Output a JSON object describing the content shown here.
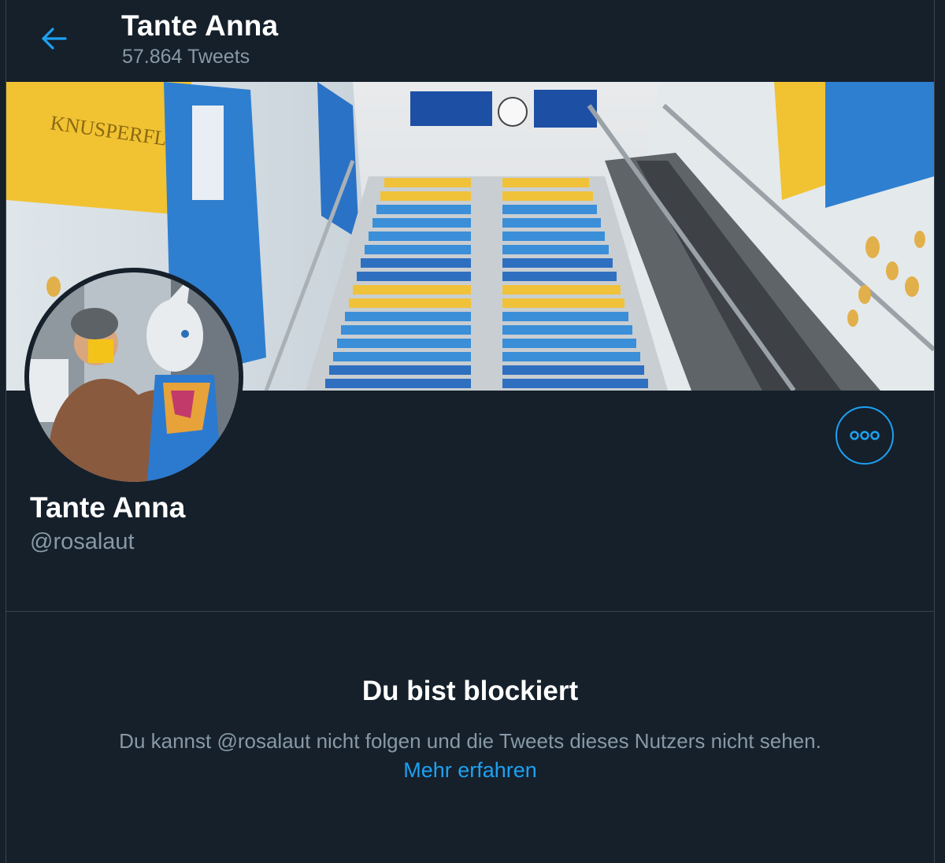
{
  "header": {
    "title": "Tante Anna",
    "tweet_count": "57.864 Tweets",
    "back_icon": "arrow-left-icon"
  },
  "banner": {
    "description_icon": "banner-image"
  },
  "profile": {
    "display_name": "Tante Anna",
    "handle": "@rosalaut",
    "more_icon": "more-options-icon"
  },
  "blocked": {
    "title": "Du bist blockiert",
    "message": "Du kannst @rosalaut nicht folgen und die Tweets dieses Nutzers nicht sehen.",
    "link": "Mehr erfahren"
  },
  "colors": {
    "background": "#15202b",
    "accent": "#1da1f2",
    "secondary_text": "#8899a6",
    "divider": "#38444d"
  }
}
